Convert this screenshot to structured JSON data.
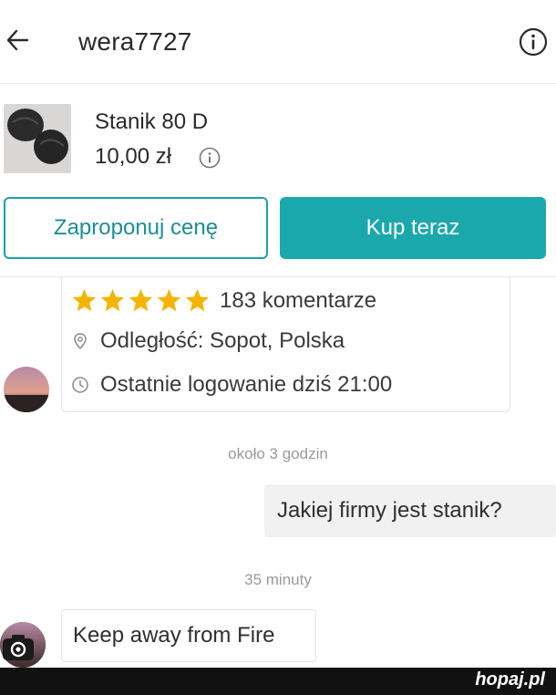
{
  "header": {
    "username": "wera7727",
    "back_icon": "arrow-left-icon",
    "info_icon": "info-circle-icon"
  },
  "item": {
    "title": "Stanik 80 D",
    "price": "10,00 zł",
    "price_info_icon": "info-circle-icon"
  },
  "actions": {
    "offer_label": "Zaproponuj cenę",
    "buy_label": "Kup teraz"
  },
  "seller": {
    "rating_stars": 5,
    "reviews": "183 komentarze",
    "location": "Odległość: Sopot, Polska",
    "last_login": "Ostatnie logowanie dziś 21:00",
    "location_icon": "location-pin-icon",
    "clock_icon": "clock-icon"
  },
  "messages": [
    {
      "time": "około  3 godzin",
      "text": "Jakiej firmy jest stanik?",
      "direction": "outgoing"
    },
    {
      "time": "35 minuty",
      "text": "Keep away from Fire",
      "direction": "incoming"
    }
  ],
  "watermark": "hopaj.pl",
  "colors": {
    "accent": "#1ba8ad",
    "star": "#f5b400",
    "background": "#ffffff"
  }
}
